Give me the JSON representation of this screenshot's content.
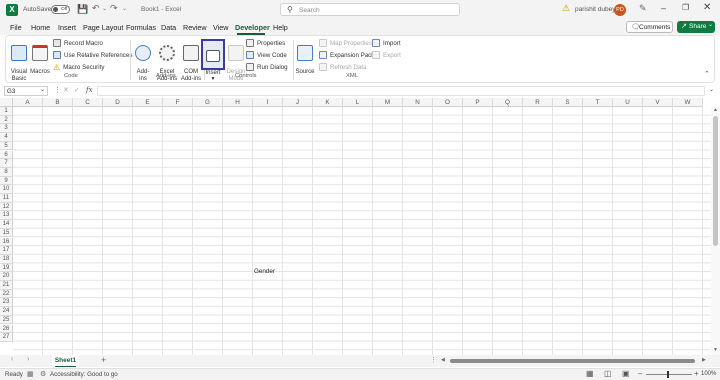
{
  "titlebar": {
    "autosave_label": "AutoSave",
    "autosave_state": "Off",
    "book_name": "Book1",
    "app_name": "Excel",
    "search_placeholder": "Search",
    "user_name": "parishit dubey",
    "user_initials": "PD"
  },
  "menu": {
    "tabs": [
      "File",
      "Home",
      "Insert",
      "Page Layout",
      "Formulas",
      "Data",
      "Review",
      "View",
      "Developer",
      "Help"
    ],
    "comments_label": "Comments",
    "share_label": "Share"
  },
  "ribbon": {
    "code": {
      "visual_basic": "Visual\nBasic",
      "macros": "Macros",
      "record_macro": "Record Macro",
      "use_relative_references": "Use Relative References",
      "macro_security": "Macro Security",
      "group_label": "Code"
    },
    "addins": {
      "addins": "Add-\nins",
      "excel_addins": "Excel\nAdd-ins",
      "com_addins": "COM\nAdd-ins",
      "group_label": "Add-ins"
    },
    "controls": {
      "insert": "Insert",
      "design_mode": "Design\nMode",
      "properties": "Properties",
      "view_code": "View Code",
      "run_dialog": "Run Dialog",
      "group_label": "Controls"
    },
    "xml": {
      "source": "Source",
      "map_properties": "Map Properties",
      "expansion_packs": "Expansion Packs",
      "refresh_data": "Refresh Data",
      "import": "Import",
      "export": "Export",
      "group_label": "XML"
    }
  },
  "formula_bar": {
    "name_box": "G3",
    "fx": "fx",
    "formula": ""
  },
  "grid": {
    "columns": [
      "A",
      "B",
      "C",
      "D",
      "E",
      "F",
      "G",
      "H",
      "I",
      "J",
      "K",
      "L",
      "M",
      "N",
      "O",
      "P",
      "Q",
      "R",
      "S",
      "T",
      "U",
      "V",
      "W"
    ],
    "rows": [
      "1",
      "2",
      "3",
      "4",
      "5",
      "6",
      "7",
      "8",
      "9",
      "10",
      "11",
      "12",
      "13",
      "14",
      "15",
      "16",
      "17",
      "18",
      "19",
      "20",
      "21",
      "22",
      "23",
      "24",
      "25",
      "26",
      "27"
    ],
    "cells": {
      "I8": "Gender"
    }
  },
  "sheets": {
    "tabs": [
      "Sheet1"
    ],
    "add_label": "+"
  },
  "status": {
    "ready": "Ready",
    "accessibility": "Accessibility: Good to go",
    "zoom": "100%"
  },
  "colors": {
    "accent": "#185c37",
    "excel_green": "#107c41",
    "avatar": "#c4581f"
  }
}
